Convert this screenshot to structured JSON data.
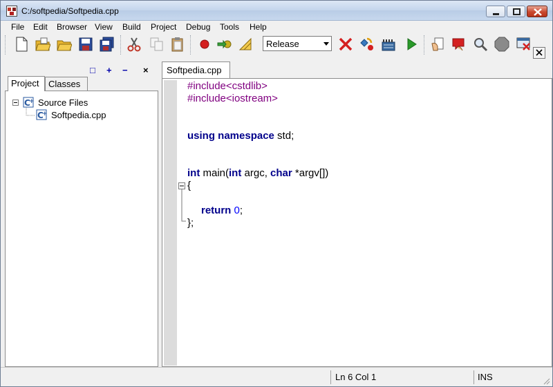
{
  "window": {
    "title": "C:/softpedia/Softpedia.cpp"
  },
  "menu": [
    "File",
    "Edit",
    "Browser",
    "View",
    "Build",
    "Project",
    "Debug",
    "Tools",
    "Help"
  ],
  "toolbar": {
    "build_config": "Release",
    "icons": [
      "new-file-icon",
      "open-project-icon",
      "open-folder-icon",
      "save-icon",
      "save-all-icon",
      "cut-icon",
      "copy-icon",
      "paste-icon",
      "breakpoint-icon",
      "step-icon",
      "compile-settings-icon",
      "stop-build-icon",
      "build-icon",
      "rebuild-icon",
      "run-icon",
      "bookmark-icon",
      "help-icon",
      "find-icon",
      "stop-icon",
      "close-all-icon"
    ],
    "accent_red": "#d42020",
    "accent_green": "#2a9a2a"
  },
  "left_panel": {
    "header_buttons": [
      "□",
      "+",
      "−",
      "×"
    ],
    "tabs": [
      "Project",
      "Classes"
    ],
    "active_tab": "Project",
    "tree": {
      "folder": "Source Files",
      "file": "Softpedia.cpp"
    }
  },
  "editor": {
    "tab": "Softpedia.cpp",
    "lines": {
      "l1": "#include<cstdlib>",
      "l2": "#include<iostream>",
      "l5_kw1": "using",
      "l5_kw2": "namespace",
      "l5_rest": " std;",
      "l8_kw1": "int",
      "l8_mid1": " main(",
      "l8_kw2": "int",
      "l8_mid2": " argc, ",
      "l8_kw3": "char",
      "l8_rest": " *argv[])",
      "l9": "{",
      "l11_kw": "return",
      "l11_num": "0",
      "l11_rest": ";",
      "l12": "};"
    }
  },
  "status": {
    "position": "Ln 6  Col 1",
    "mode": "INS"
  }
}
